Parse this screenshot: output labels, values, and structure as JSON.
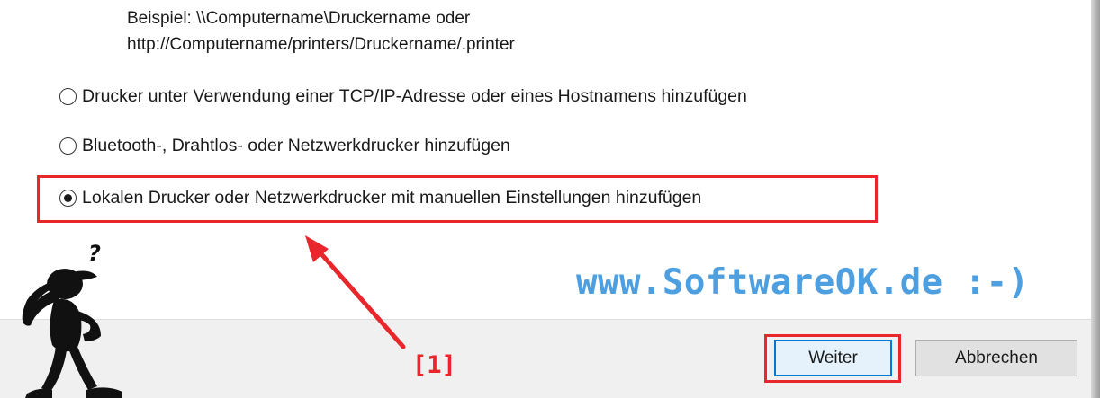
{
  "example": {
    "line1": "Beispiel: \\\\Computername\\Druckername oder",
    "line2": "http://Computername/printers/Druckername/.printer"
  },
  "options": [
    {
      "label": "Drucker unter Verwendung einer TCP/IP-Adresse oder eines Hostnamens hinzufügen",
      "selected": false
    },
    {
      "label": "Bluetooth-, Drahtlos- oder Netzwerkdrucker hinzufügen",
      "selected": false
    },
    {
      "label": "Lokalen Drucker oder Netzwerkdrucker mit manuellen Einstellungen hinzufügen",
      "selected": true
    }
  ],
  "annotation": {
    "watermark": "www.SoftwareOK.de :-)",
    "callout": "[1]",
    "figure_mark": "?",
    "highlight_color": "#e8262c",
    "watermark_color": "#4d9fe0"
  },
  "buttons": {
    "next": "Weiter",
    "cancel": "Abbrechen"
  },
  "colors": {
    "footer_bg": "#f0f0f0",
    "primary_border": "#0078d7"
  }
}
